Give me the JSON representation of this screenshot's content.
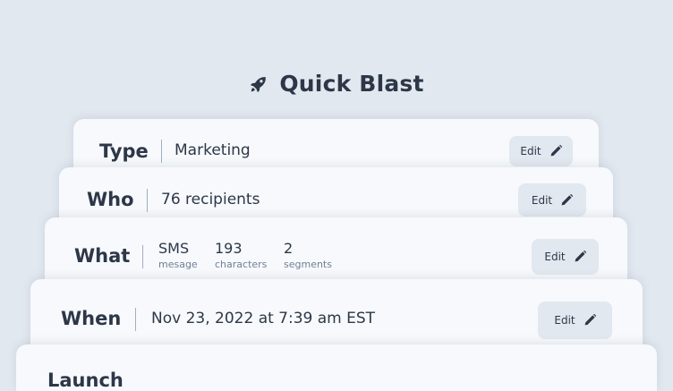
{
  "header": {
    "icon": "rocket-icon",
    "title": "Quick Blast"
  },
  "steps": {
    "type": {
      "label": "Type",
      "value": "Marketing",
      "edit_label": "Edit"
    },
    "who": {
      "label": "Who",
      "value": "76 recipients",
      "edit_label": "Edit"
    },
    "what": {
      "label": "What",
      "stats": [
        {
          "value": "SMS",
          "unit": "mesage"
        },
        {
          "value": "193",
          "unit": "characters"
        },
        {
          "value": "2",
          "unit": "segments"
        }
      ],
      "edit_label": "Edit"
    },
    "when": {
      "label": "When",
      "value": "Nov 23, 2022 at 7:39 am EST",
      "edit_label": "Edit"
    },
    "launch": {
      "label": "Launch"
    }
  },
  "colors": {
    "background": "#e2e8f0",
    "card": "#f7f9fc",
    "text": "#2d3748",
    "muted": "#718096",
    "button": "#e2e8f0"
  }
}
